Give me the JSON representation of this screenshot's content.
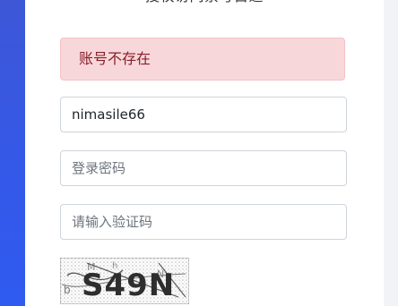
{
  "login": {
    "title": "授权访问禁号占道",
    "error_message": "账号不存在",
    "username_value": "nimasile66",
    "password_placeholder": "登录密码",
    "captcha_placeholder": "请输入验证码",
    "captcha_code": "S49N"
  },
  "colors": {
    "sidebar_blue": "#3458e8",
    "alert_bg": "#f8d7da",
    "alert_text": "#842029",
    "input_border": "#ced4da"
  }
}
